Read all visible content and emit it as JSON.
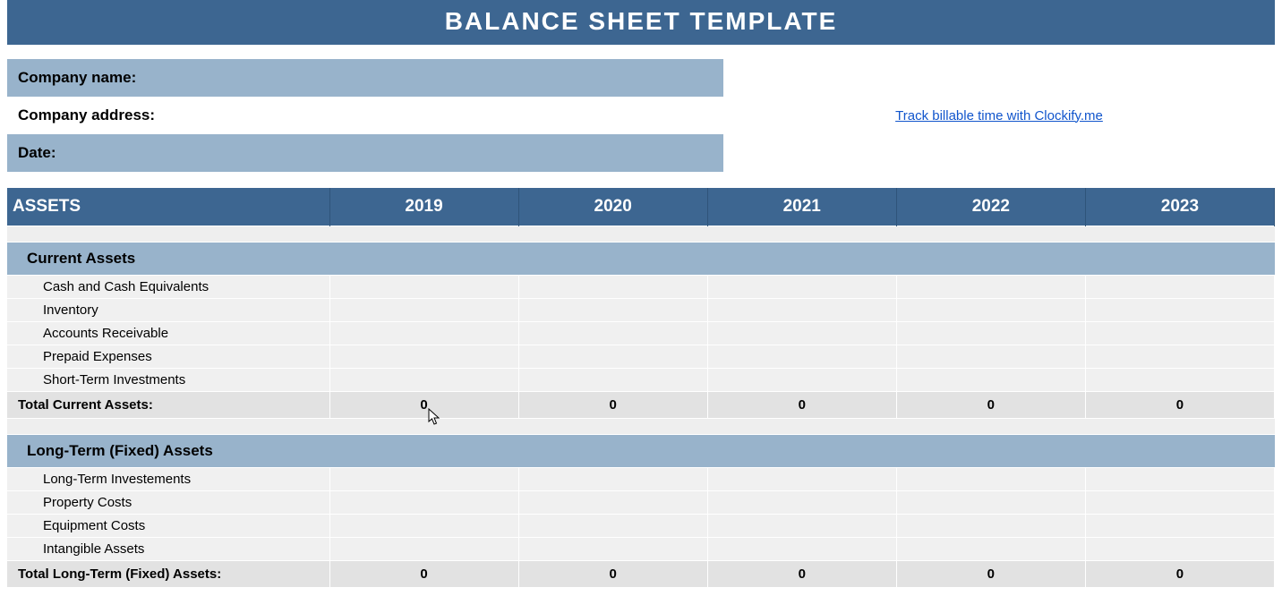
{
  "title": "BALANCE SHEET TEMPLATE",
  "info": {
    "company_name_label": "Company name:",
    "company_address_label": "Company address:",
    "date_label": "Date:",
    "clockify_link": "Track billable time with Clockify.me"
  },
  "section_header": "ASSETS",
  "years": [
    "2019",
    "2020",
    "2021",
    "2022",
    "2023"
  ],
  "current_assets": {
    "header": "Current Assets",
    "items": [
      "Cash and Cash Equivalents",
      "Inventory",
      "Accounts Receivable",
      "Prepaid Expenses",
      "Short-Term Investments"
    ],
    "total_label": "Total Current Assets:",
    "totals": [
      "0",
      "0",
      "0",
      "0",
      "0"
    ]
  },
  "long_term_assets": {
    "header": "Long-Term (Fixed) Assets",
    "items": [
      "Long-Term Investements",
      "Property Costs",
      "Equipment Costs",
      "Intangible Assets"
    ],
    "total_label": "Total Long-Term (Fixed) Assets:",
    "totals": [
      "0",
      "0",
      "0",
      "0",
      "0"
    ]
  }
}
